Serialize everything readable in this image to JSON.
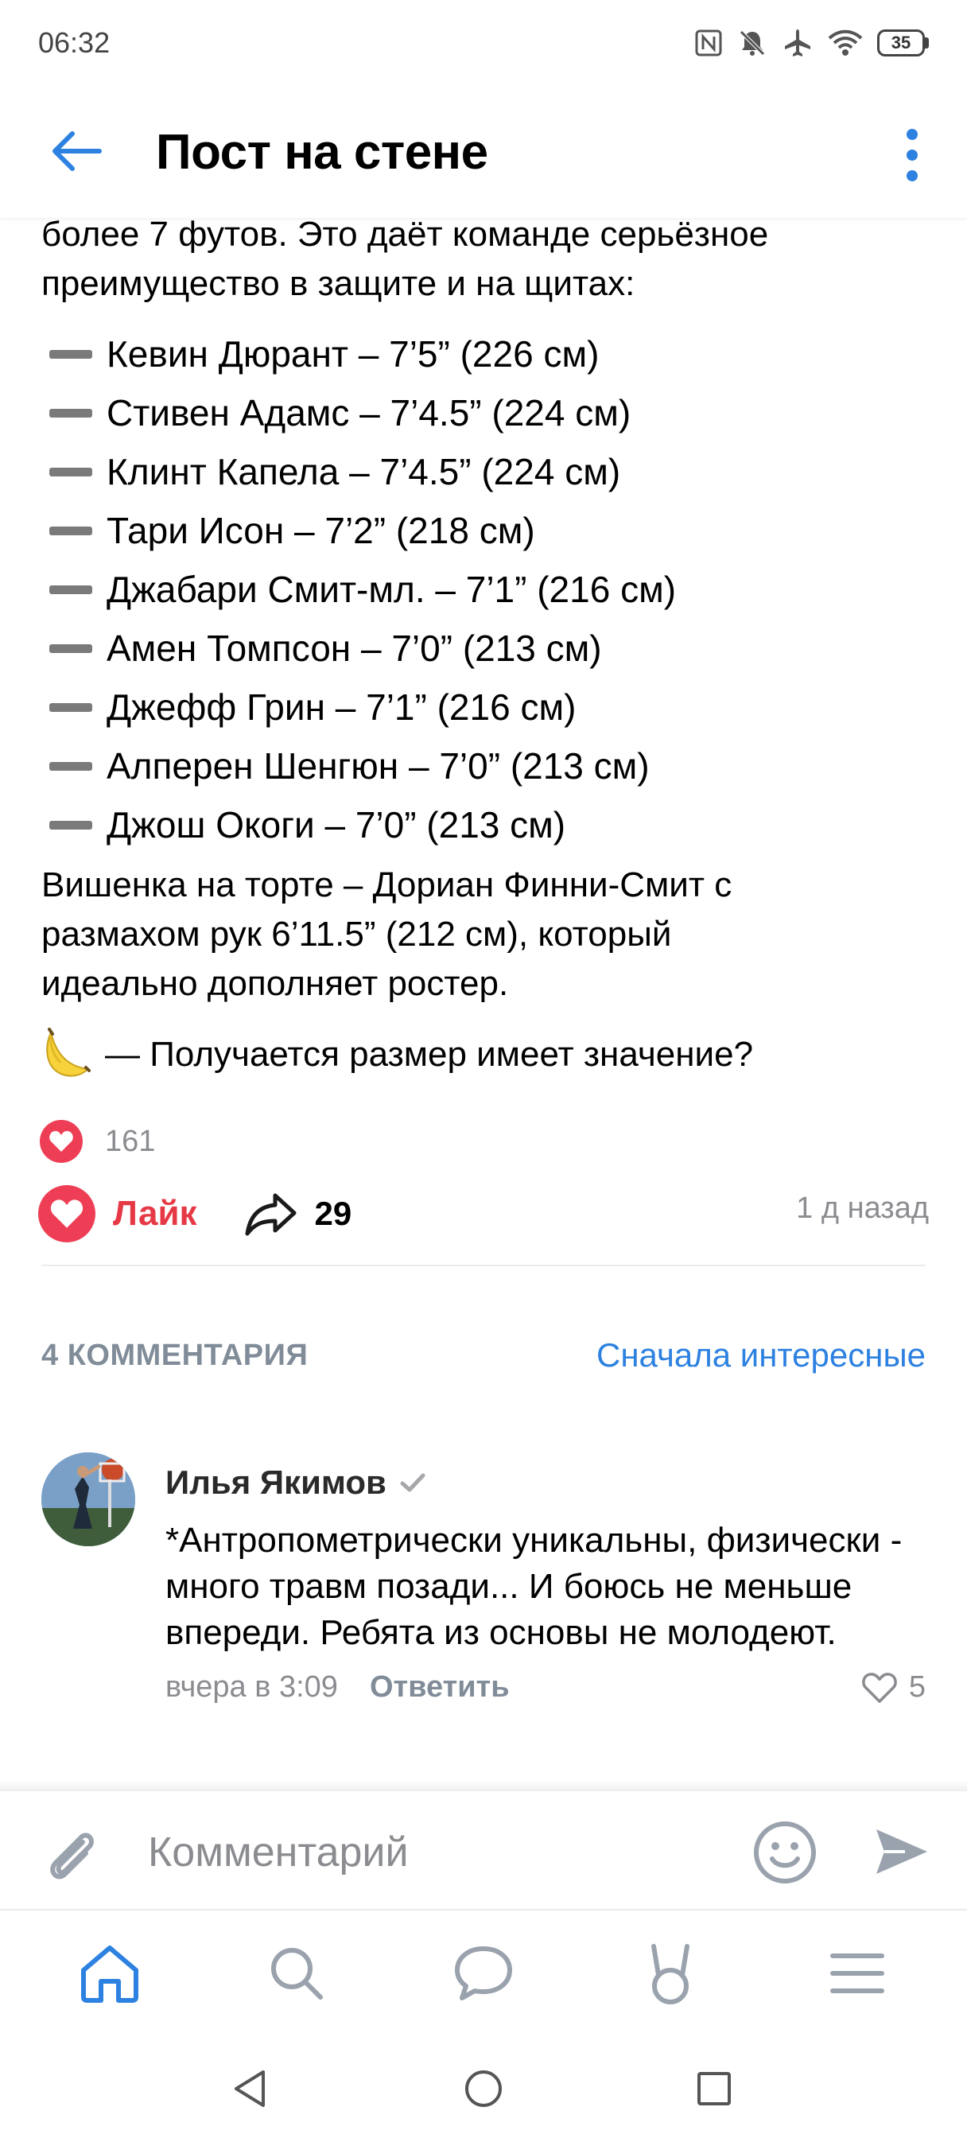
{
  "status_bar": {
    "time": "06:32",
    "battery": "35",
    "icons": [
      "nfc-icon",
      "bell-muted-icon",
      "airplane-icon",
      "wifi-icon",
      "battery-icon"
    ]
  },
  "header": {
    "title": "Пост на стене"
  },
  "post": {
    "intro_lines": [
      "более 7 футов. Это даёт команде серьёзное",
      "преимущество в защите и на щитах:"
    ],
    "players": [
      "Кевин Дюрант – 7’5” (226 см)",
      "Стивен Адамс – 7’4.5” (224 см)",
      "Клинт Капела – 7’4.5” (224 см)",
      "Тари Исон – 7’2” (218 см)",
      "Джабари Смит-мл. – 7’1” (216 см)",
      "Амен Томпсон – 7’0” (213 см)",
      "Джефф Грин – 7’1” (216 см)",
      "Алперен Шенгюн – 7’0” (213 см)",
      "Джош Окоги – 7’0” (213 см)"
    ],
    "closing_lines": [
      "Вишенка на торте – Дориан Финни-Смит с",
      "размахом рук 6’11.5” (212 см), который",
      "идеально дополняет ростер."
    ],
    "question": "— Получается размер имеет значение?"
  },
  "reactions": {
    "count": "161",
    "like_label": "Лайк",
    "share_count": "29",
    "time": "1 д назад"
  },
  "comments": {
    "count_label": "4 КОММЕНТАРИЯ",
    "sort_label": "Сначала интересные",
    "items": [
      {
        "author": "Илья Якимов",
        "text": "*Антропометрически уникальны, физически - много травм позади... И боюсь не меньше впереди. Ребята из основы не молодеют.",
        "date": "вчера в 3:09",
        "reply_label": "Ответить",
        "likes": "5"
      }
    ]
  },
  "composer": {
    "placeholder": "Комментарий"
  },
  "colors": {
    "accent": "#2d81e0",
    "like": "#ee3e55",
    "secondary_text": "#8a8c90"
  }
}
